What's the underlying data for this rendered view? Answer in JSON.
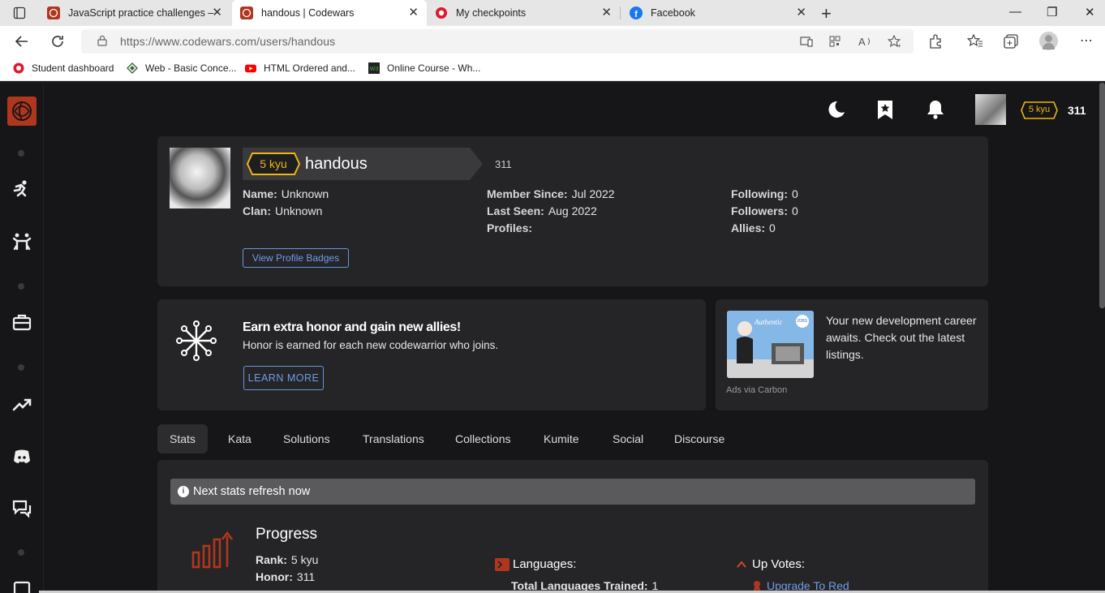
{
  "browser": {
    "tabs": [
      {
        "title": "JavaScript practice challenges – t",
        "icon": "codewars-icon"
      },
      {
        "title": "handous | Codewars",
        "icon": "codewars-icon"
      },
      {
        "title": "My checkpoints",
        "icon": "checkpoint-icon"
      },
      {
        "title": "Facebook",
        "icon": "facebook-icon"
      }
    ],
    "close_glyph": "✕",
    "newtab_glyph": "+",
    "url": "https://www.codewars.com/users/handous",
    "bookmarks": [
      {
        "label": "Student dashboard",
        "icon": "checkpoint-icon"
      },
      {
        "label": "Web - Basic Conce...",
        "icon": "diamond-icon"
      },
      {
        "label": "HTML Ordered and...",
        "icon": "youtube-icon"
      },
      {
        "label": "Online Course - Wh...",
        "icon": "w3-icon"
      }
    ],
    "controls": {
      "minimize": "—",
      "maximize": "❐",
      "close": "✕"
    }
  },
  "header": {
    "rank": "5 kyu",
    "honor": "311"
  },
  "profile": {
    "rank": "5 kyu",
    "username": "handous",
    "honor": "311",
    "name_label": "Name:",
    "name_value": "Unknown",
    "clan_label": "Clan:",
    "clan_value": "Unknown",
    "member_label": "Member Since:",
    "member_value": "Jul 2022",
    "seen_label": "Last Seen:",
    "seen_value": "Aug 2022",
    "profiles_label": "Profiles:",
    "following_label": "Following:",
    "following_value": "0",
    "followers_label": "Followers:",
    "followers_value": "0",
    "allies_label": "Allies:",
    "allies_value": "0",
    "badges_button": "View Profile Badges"
  },
  "referral": {
    "title": "Earn extra honor and gain new allies!",
    "description": "Honor is earned for each new codewarrior who joins.",
    "button": "LEARN MORE"
  },
  "ad": {
    "text": "Your new development career awaits. Check out the latest listings.",
    "via": "Ads via Carbon",
    "image_caption": "Authentic",
    "image_badge": "JOBS"
  },
  "tabs": [
    "Stats",
    "Kata",
    "Solutions",
    "Translations",
    "Collections",
    "Kumite",
    "Social",
    "Discourse"
  ],
  "stats": {
    "refresh": "Next stats refresh now",
    "progress_title": "Progress",
    "rank_label": "Rank:",
    "rank_value": "5 kyu",
    "honor_label": "Honor:",
    "honor_value": "311",
    "languages_title": "Languages:",
    "languages_trained_label": "Total Languages Trained:",
    "languages_trained_value": "1",
    "upvotes_title": "Up Votes:",
    "upgrade_link": "Upgrade To Red"
  },
  "colors": {
    "accent": "#b1361e",
    "rank": "#ecb613",
    "link": "#6f9cea",
    "panel": "#252527",
    "bg": "#161618"
  }
}
